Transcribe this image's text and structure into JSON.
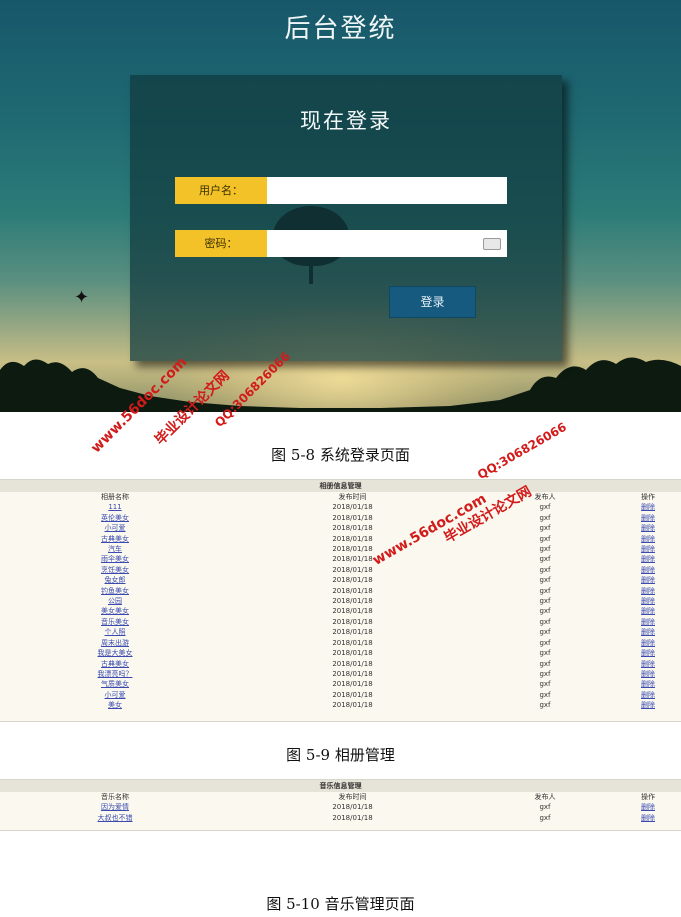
{
  "app_title": "后台登统",
  "login": {
    "title": "现在登录",
    "username_label": "用户名：",
    "password_label": "密码：",
    "submit_label": "登录"
  },
  "captions": {
    "fig_5_8": "图 5-8 系统登录页面",
    "fig_5_9": "图 5-9 相册管理",
    "fig_5_10": "图 5-10 音乐管理页面"
  },
  "album_panel": {
    "title": "相册信息管理",
    "columns": [
      "相册名称",
      "发布时间",
      "发布人",
      "操作"
    ],
    "rows": [
      {
        "name": "111",
        "date": "2018/01/18",
        "author": "gxf",
        "action": "删除"
      },
      {
        "name": "英伦美女",
        "date": "2018/01/18",
        "author": "gxf",
        "action": "删除"
      },
      {
        "name": "小可爱",
        "date": "2018/01/18",
        "author": "gxf",
        "action": "删除"
      },
      {
        "name": "古典美女",
        "date": "2018/01/18",
        "author": "gxf",
        "action": "删除"
      },
      {
        "name": "汽车",
        "date": "2018/01/18",
        "author": "gxf",
        "action": "删除"
      },
      {
        "name": "雨伞美女",
        "date": "2018/01/18",
        "author": "gxf",
        "action": "删除"
      },
      {
        "name": "烹饪美女",
        "date": "2018/01/18",
        "author": "gxf",
        "action": "删除"
      },
      {
        "name": "兔女郎",
        "date": "2018/01/18",
        "author": "gxf",
        "action": "删除"
      },
      {
        "name": "钓鱼美女",
        "date": "2018/01/18",
        "author": "gxf",
        "action": "删除"
      },
      {
        "name": "公园",
        "date": "2018/01/18",
        "author": "gxf",
        "action": "删除"
      },
      {
        "name": "美女美女",
        "date": "2018/01/18",
        "author": "gxf",
        "action": "删除"
      },
      {
        "name": "音乐美女",
        "date": "2018/01/18",
        "author": "gxf",
        "action": "删除"
      },
      {
        "name": "个人照",
        "date": "2018/01/18",
        "author": "gxf",
        "action": "删除"
      },
      {
        "name": "周末出游",
        "date": "2018/01/18",
        "author": "gxf",
        "action": "删除"
      },
      {
        "name": "我是大美女",
        "date": "2018/01/18",
        "author": "gxf",
        "action": "删除"
      },
      {
        "name": "古典美女",
        "date": "2018/01/18",
        "author": "gxf",
        "action": "删除"
      },
      {
        "name": "我漂亮吗？",
        "date": "2018/01/18",
        "author": "gxf",
        "action": "删除"
      },
      {
        "name": "气质美女",
        "date": "2018/01/18",
        "author": "gxf",
        "action": "删除"
      },
      {
        "name": "小可爱",
        "date": "2018/01/18",
        "author": "gxf",
        "action": "删除"
      },
      {
        "name": "美女",
        "date": "2018/01/18",
        "author": "gxf",
        "action": "删除"
      }
    ]
  },
  "music_panel": {
    "title": "音乐信息管理",
    "columns": [
      "音乐名称",
      "发布时间",
      "发布人",
      "操作"
    ],
    "rows": [
      {
        "name": "因为爱情",
        "date": "2018/01/18",
        "author": "gxf",
        "action": "删除"
      },
      {
        "name": "大叔也不错",
        "date": "2018/01/18",
        "author": "gxf",
        "action": "删除"
      }
    ]
  },
  "watermarks": {
    "site": "www.56doc.com",
    "brand": "毕业设计论文网",
    "qq": "QQ:306826066"
  },
  "colors": {
    "label_bg": "#f3c128",
    "button_bg": "#165a80",
    "watermark": "#d21b1b"
  }
}
